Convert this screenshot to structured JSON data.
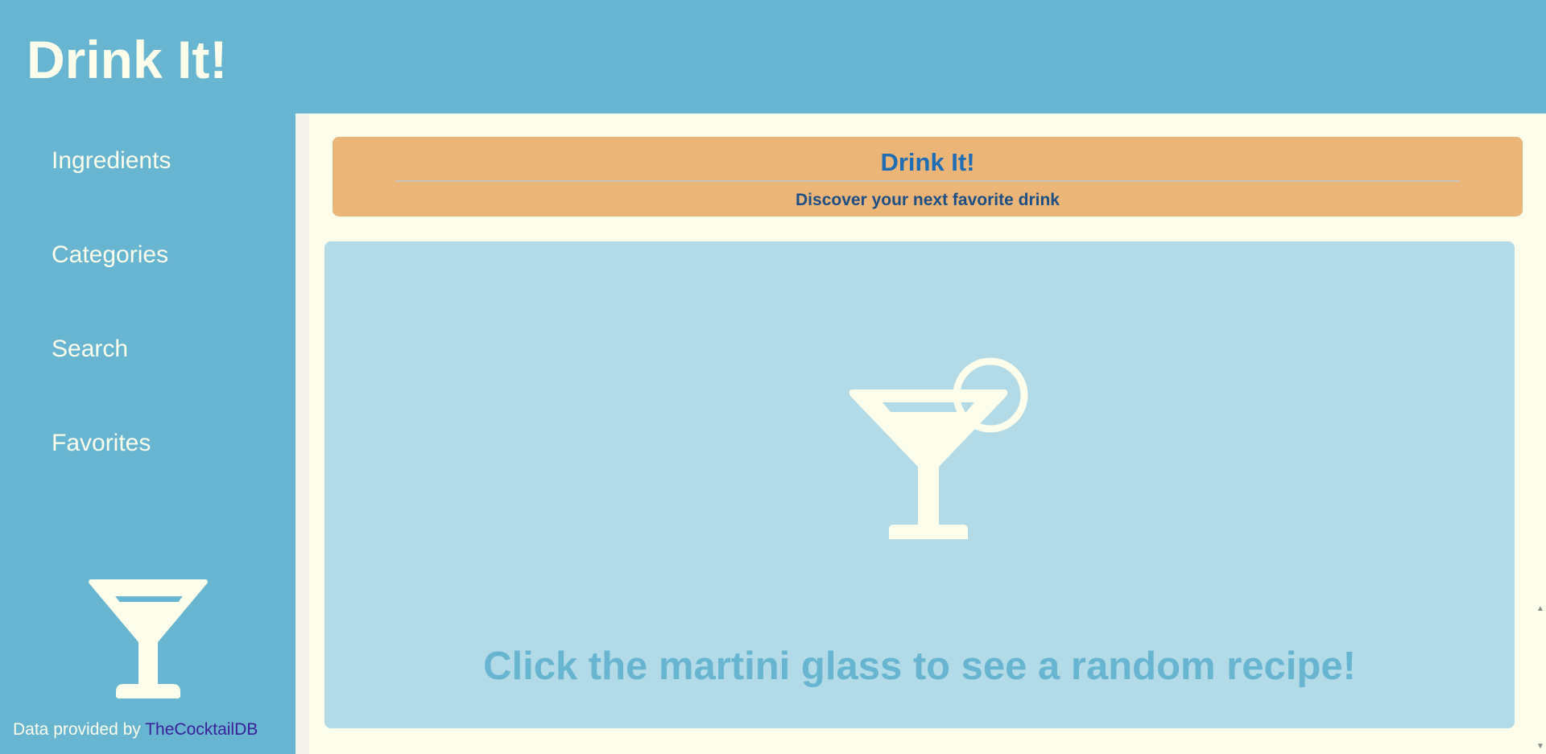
{
  "app": {
    "brand": "Drink It!"
  },
  "sidebar": {
    "items": [
      {
        "label": "Ingredients"
      },
      {
        "label": "Categories"
      },
      {
        "label": "Search"
      },
      {
        "label": "Favorites"
      }
    ],
    "credit_prefix": "Data provided by ",
    "credit_link": "TheCocktailDB"
  },
  "banner": {
    "title": "Drink It!",
    "subtitle": "Discover your next favorite drink"
  },
  "card": {
    "prompt": "Click the martini glass to see a random recipe!"
  },
  "colors": {
    "primary": "#67b5d1",
    "cream": "#fdfdeb",
    "banner": "#ebb577",
    "card": "#b2dae7",
    "title_blue": "#1e6db5",
    "link": "#3a1f9a"
  },
  "icons": {
    "sidebar_icon": "martini-glass-icon",
    "card_icon": "martini-glass-lime-icon"
  }
}
